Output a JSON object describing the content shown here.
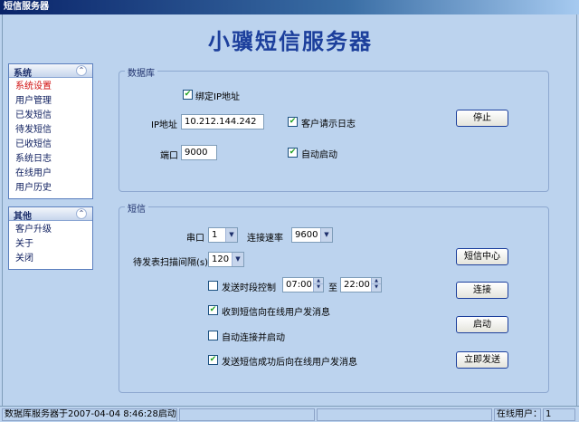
{
  "window": {
    "title": "短信服务器"
  },
  "banner": "小骥短信服务器",
  "nav": {
    "system": {
      "title": "系统",
      "items": [
        "系统设置",
        "用户管理",
        "已发短信",
        "待发短信",
        "已收短信",
        "系统日志",
        "在线用户",
        "用户历史"
      ],
      "active_index": 0
    },
    "other": {
      "title": "其他",
      "items": [
        "客户升级",
        "关于",
        "关闭"
      ]
    }
  },
  "database": {
    "title": "数据库",
    "bind_ip_label": "绑定IP地址",
    "bind_ip_checked": true,
    "ip_label": "IP地址",
    "ip_value": "10.212.144.242",
    "port_label": "端口",
    "port_value": "9000",
    "client_log_label": "客户请示日志",
    "client_log_checked": true,
    "auto_start_label": "自动启动",
    "auto_start_checked": true,
    "stop_button": "停止"
  },
  "sms": {
    "title": "短信",
    "serial_label": "串口",
    "serial_value": "1",
    "baud_label": "连接速率",
    "baud_value": "9600",
    "scan_label": "待发表扫描间隔(s)",
    "scan_value": "120",
    "time_ctrl_label": "发送时段控制",
    "time_ctrl_checked": false,
    "time_from": "07:00",
    "to_label": "至",
    "time_to": "22:00",
    "notify_recv_label": "收到短信向在线用户发消息",
    "notify_recv_checked": true,
    "auto_connect_label": "自动连接并启动",
    "auto_connect_checked": false,
    "notify_sent_label": "发送短信成功后向在线用户发消息",
    "notify_sent_checked": true,
    "center_button": "短信中心",
    "connect_button": "连接",
    "start_button": "启动",
    "send_now_button": "立即发送"
  },
  "status": {
    "message": "数据库服务器于2007-04-04 8:46:28启动。",
    "online_label": "在线用户：",
    "online_count": "1"
  },
  "colors": {
    "background": "#bcd3ee",
    "accent": "#1c3f9c",
    "active_nav": "#d01010",
    "check": "#21a121"
  }
}
